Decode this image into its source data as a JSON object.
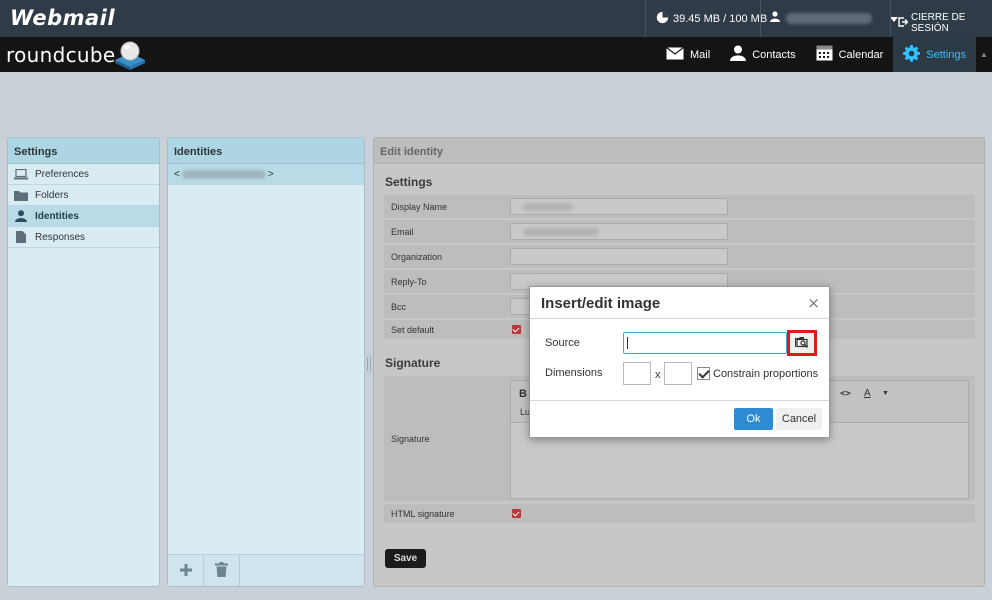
{
  "topbar": {
    "logo": "Webmail",
    "quota": "39.45 MB / 100 MB",
    "logout": "CIERRE DE SESIÓN"
  },
  "header": {
    "logo": "roundcube",
    "nav": [
      {
        "label": "Mail",
        "icon": "envelope-icon"
      },
      {
        "label": "Contacts",
        "icon": "person-icon"
      },
      {
        "label": "Calendar",
        "icon": "calendar-icon"
      },
      {
        "label": "Settings",
        "icon": "gear-icon",
        "active": true
      }
    ]
  },
  "settings_panel": {
    "title": "Settings",
    "items": [
      {
        "label": "Preferences",
        "icon": "laptop-icon"
      },
      {
        "label": "Folders",
        "icon": "folder-icon"
      },
      {
        "label": "Identities",
        "icon": "user-icon",
        "selected": true
      },
      {
        "label": "Responses",
        "icon": "document-icon"
      }
    ]
  },
  "identities_panel": {
    "title": "Identities",
    "row_prefix": "<",
    "row_suffix": ">"
  },
  "edit_identity": {
    "title": "Edit identity",
    "settings_heading": "Settings",
    "fields": {
      "display_name": "Display Name",
      "email": "Email",
      "organization": "Organization",
      "reply_to": "Reply-To",
      "bcc": "Bcc",
      "set_default": "Set default"
    },
    "signature_heading": "Signature",
    "signature_label": "Signature",
    "signature_toolbar": {
      "bold": "B",
      "font": "Lu",
      "code": "<>",
      "font_color": "A"
    },
    "html_signature": "HTML signature",
    "save": "Save"
  },
  "modal": {
    "title": "Insert/edit image",
    "close": "×",
    "source_label": "Source",
    "source_value": "",
    "dimensions_label": "Dimensions",
    "dimensions_x": "x",
    "constrain": "Constrain proportions",
    "ok": "Ok",
    "cancel": "Cancel"
  }
}
